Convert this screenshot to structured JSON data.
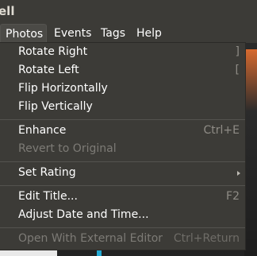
{
  "window": {
    "title_fragment": "ell"
  },
  "menubar": {
    "items": [
      {
        "label": "Photos"
      },
      {
        "label": "Events"
      },
      {
        "label": "Tags"
      },
      {
        "label": "Help"
      }
    ]
  },
  "photos_menu": {
    "items": [
      {
        "label": "Rotate Right",
        "shortcut": "]"
      },
      {
        "label": "Rotate Left",
        "shortcut": "["
      },
      {
        "label": "Flip Horizontally",
        "shortcut": ""
      },
      {
        "label": "Flip Vertically",
        "shortcut": ""
      },
      {
        "label": "Enhance",
        "shortcut": "Ctrl+E"
      },
      {
        "label": "Revert to Original",
        "shortcut": "",
        "disabled": true
      },
      {
        "label": "Set Rating",
        "shortcut": "",
        "submenu": true
      },
      {
        "label": "Edit Title...",
        "shortcut": "F2"
      },
      {
        "label": "Adjust Date and Time...",
        "shortcut": ""
      },
      {
        "label": "Open With External Editor",
        "shortcut": "Ctrl+Return",
        "disabled": true
      }
    ]
  },
  "colors": {
    "panel": "#3c3b37",
    "text": "#ffffff",
    "disabled_text": "#7d7b76",
    "accent_cyan": "#22a9d3",
    "accent_orange": "#d76a2f"
  }
}
